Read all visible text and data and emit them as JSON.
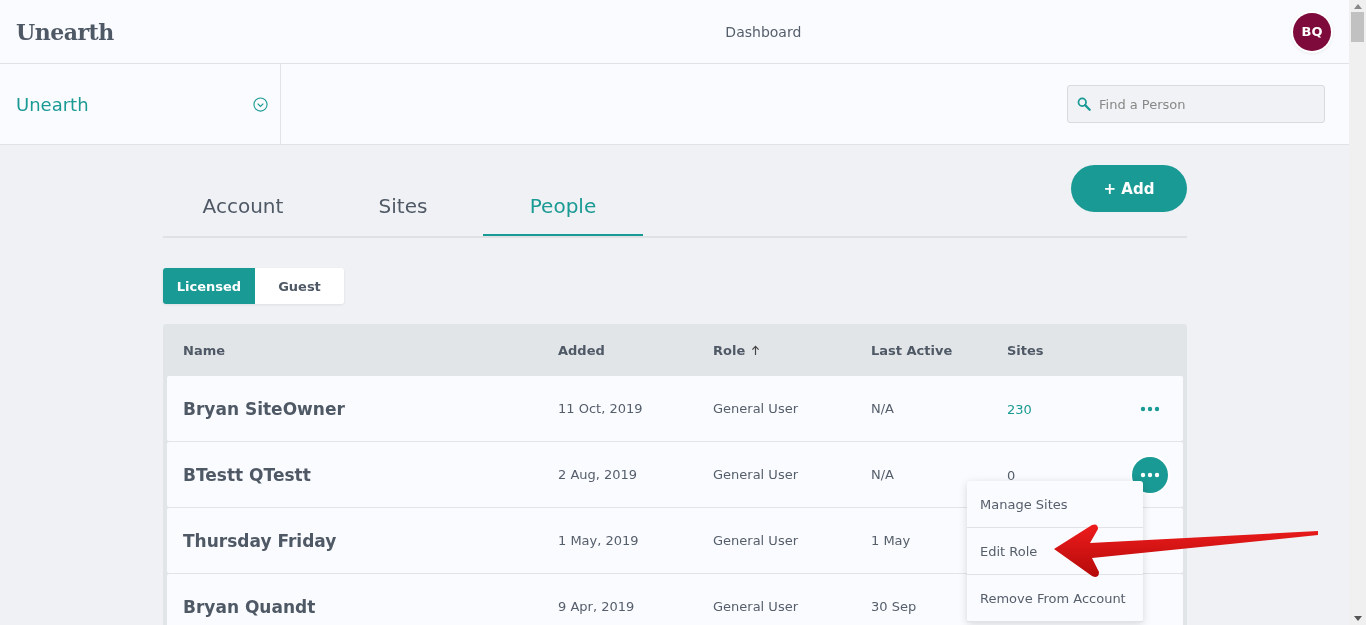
{
  "header": {
    "logo": "Unearth",
    "title": "Dashboard",
    "avatar": "BQ"
  },
  "org_selector": {
    "name": "Unearth"
  },
  "search": {
    "placeholder": "Find a Person"
  },
  "tabs": [
    {
      "label": "Account",
      "selected": false
    },
    {
      "label": "Sites",
      "selected": false
    },
    {
      "label": "People",
      "selected": true
    }
  ],
  "add_button": {
    "label": "+ Add"
  },
  "segments": [
    {
      "label": "Licensed",
      "selected": true
    },
    {
      "label": "Guest",
      "selected": false
    }
  ],
  "table": {
    "columns": [
      {
        "label": "Name",
        "sorted": false
      },
      {
        "label": "Added",
        "sorted": false
      },
      {
        "label": "Role",
        "sorted": true
      },
      {
        "label": "Last Active",
        "sorted": false
      },
      {
        "label": "Sites",
        "sorted": false
      }
    ],
    "rows": [
      {
        "name": "Bryan SiteOwner",
        "added": "11 Oct, 2019",
        "role": "General User",
        "last_active": "N/A",
        "sites": "230",
        "sites_link": true,
        "actions_visible": true,
        "menu_open": false
      },
      {
        "name": "BTestt QTestt",
        "added": "2 Aug, 2019",
        "role": "General User",
        "last_active": "N/A",
        "sites": "0",
        "sites_link": false,
        "actions_visible": true,
        "menu_open": true
      },
      {
        "name": "Thursday Friday",
        "added": "1 May, 2019",
        "role": "General User",
        "last_active": "1 May",
        "actions_visible": false
      },
      {
        "name": "Bryan Quandt",
        "added": "9 Apr, 2019",
        "role": "General User",
        "last_active": "30 Sep",
        "actions_visible": false
      }
    ]
  },
  "row_menu": {
    "items": [
      "Manage Sites",
      "Edit Role",
      "Remove From Account"
    ]
  }
}
